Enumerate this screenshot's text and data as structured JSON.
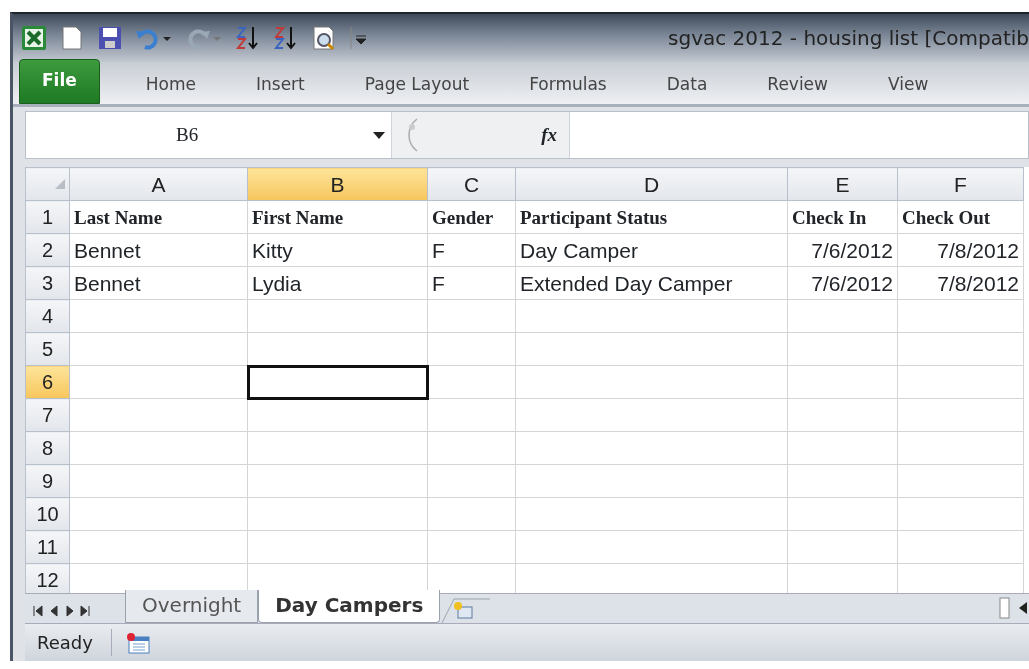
{
  "window": {
    "title": "sgvac 2012 - housing list  [Compatib"
  },
  "ribbon_tabs": [
    {
      "label": "File",
      "kind": "file",
      "selected": false
    },
    {
      "label": "Home",
      "kind": "tab",
      "selected": false
    },
    {
      "label": "Insert",
      "kind": "tab",
      "selected": false
    },
    {
      "label": "Page Layout",
      "kind": "tab",
      "selected": false
    },
    {
      "label": "Formulas",
      "kind": "tab",
      "selected": false
    },
    {
      "label": "Data",
      "kind": "tab",
      "selected": false
    },
    {
      "label": "Review",
      "kind": "tab",
      "selected": false
    },
    {
      "label": "View",
      "kind": "tab",
      "selected": false
    }
  ],
  "name_box": {
    "value": "B6"
  },
  "formula_bar": {
    "function_label": "fx"
  },
  "columns": [
    {
      "label": "A",
      "selected": false
    },
    {
      "label": "B",
      "selected": true
    },
    {
      "label": "C",
      "selected": false
    },
    {
      "label": "D",
      "selected": false
    },
    {
      "label": "E",
      "selected": false
    },
    {
      "label": "F",
      "selected": false
    }
  ],
  "rows": [
    {
      "number": "1",
      "selected": false,
      "kind": "header",
      "cells": [
        {
          "text": "Last Name"
        },
        {
          "text": "First Name"
        },
        {
          "text": "Gender"
        },
        {
          "text": "Participant Status"
        },
        {
          "text": "Check In"
        },
        {
          "text": "Check Out"
        }
      ]
    },
    {
      "number": "2",
      "selected": false,
      "kind": "data",
      "cells": [
        {
          "text": "Bennet",
          "kind": "text"
        },
        {
          "text": "Kitty",
          "kind": "text"
        },
        {
          "text": "F",
          "kind": "text"
        },
        {
          "text": "Day Camper",
          "kind": "text"
        },
        {
          "text": "7/6/2012",
          "kind": "number"
        },
        {
          "text": "7/8/2012",
          "kind": "number"
        }
      ]
    },
    {
      "number": "3",
      "selected": false,
      "kind": "data",
      "cells": [
        {
          "text": "Bennet",
          "kind": "text"
        },
        {
          "text": "Lydia",
          "kind": "text"
        },
        {
          "text": "F",
          "kind": "text"
        },
        {
          "text": "Extended Day Camper",
          "kind": "text"
        },
        {
          "text": "7/6/2012",
          "kind": "number"
        },
        {
          "text": "7/8/2012",
          "kind": "number"
        }
      ]
    },
    {
      "number": "4",
      "selected": false
    },
    {
      "number": "5",
      "selected": false
    },
    {
      "number": "6",
      "selected": true
    },
    {
      "number": "7",
      "selected": false
    },
    {
      "number": "8",
      "selected": false
    },
    {
      "number": "9",
      "selected": false
    },
    {
      "number": "10",
      "selected": false
    },
    {
      "number": "11",
      "selected": false
    },
    {
      "number": "12",
      "selected": false
    }
  ],
  "sheet_tabs": [
    {
      "label": "Overnight",
      "selected": false
    },
    {
      "label": "Day Campers",
      "selected": true
    }
  ],
  "status_bar": {
    "text": "Ready"
  }
}
